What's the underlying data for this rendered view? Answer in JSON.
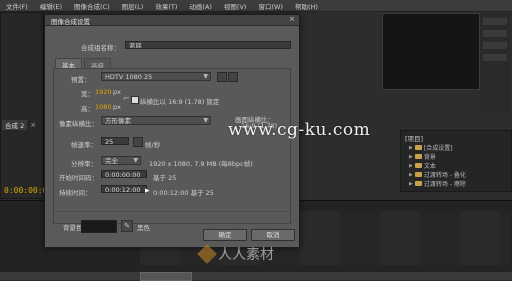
{
  "menubar": [
    "文件(F)",
    "编辑(E)",
    "图像合成(C)",
    "图层(L)",
    "效果(T)",
    "动画(A)",
    "视图(V)",
    "窗口(W)",
    "帮助(H)"
  ],
  "comp_tab": {
    "name": "合成 2",
    "close": "×"
  },
  "background_timecode": "0:00:00:00",
  "dialog": {
    "title": "图像合成设置",
    "close": "×",
    "name_label": "合成组名称：",
    "name_value": "蓝底",
    "tabs": [
      "基本",
      "高级"
    ],
    "preset_label": "预置：",
    "preset_value": "HDTV 1080 25",
    "width_label": "宽：",
    "width_value": "1920",
    "width_unit": "px",
    "lock_label": "纵横比以 16:9 (1.78) 锁定",
    "height_label": "高：",
    "height_value": "1080",
    "height_unit": "px",
    "pixel_aspect_label": "像素纵横比：",
    "pixel_aspect_value": "方形像素",
    "frame_aspect_label": "画面纵横比：",
    "frame_aspect_value": "16:9 (1.78)",
    "fps_label": "帧速率：",
    "fps_value": "25",
    "fps_unit": "帧/秒",
    "resolution_label": "分辨率：",
    "resolution_value": "完全",
    "resolution_info": "1920 x 1080, 7.9 MB (每8bpc帧)",
    "start_label": "开始时间码：",
    "start_value": "0:00:00:00",
    "start_base": "基于 25",
    "duration_label": "持续时间：",
    "duration_value": "0:00:12:00",
    "duration_info": "0:00:12:00  基于 25",
    "bg_label": "背景色：",
    "bg_name": "黑色",
    "bg_color": "#1a1a1a",
    "ok": "确定",
    "cancel": "取消"
  },
  "project": {
    "title": "[项目]",
    "items": [
      {
        "label": "[合成设置]"
      },
      {
        "label": "背景"
      },
      {
        "label": "文本"
      },
      {
        "label": "过渡转场 - 叠化"
      },
      {
        "label": "过渡转场 - 擦除"
      }
    ]
  },
  "watermark": "www.cg-ku.com",
  "watermark_logo_text": "人人素材",
  "colors": {
    "accent": "#e8a000",
    "dialog_bg": "#5a5a5a",
    "panel_bg": "#272727"
  }
}
